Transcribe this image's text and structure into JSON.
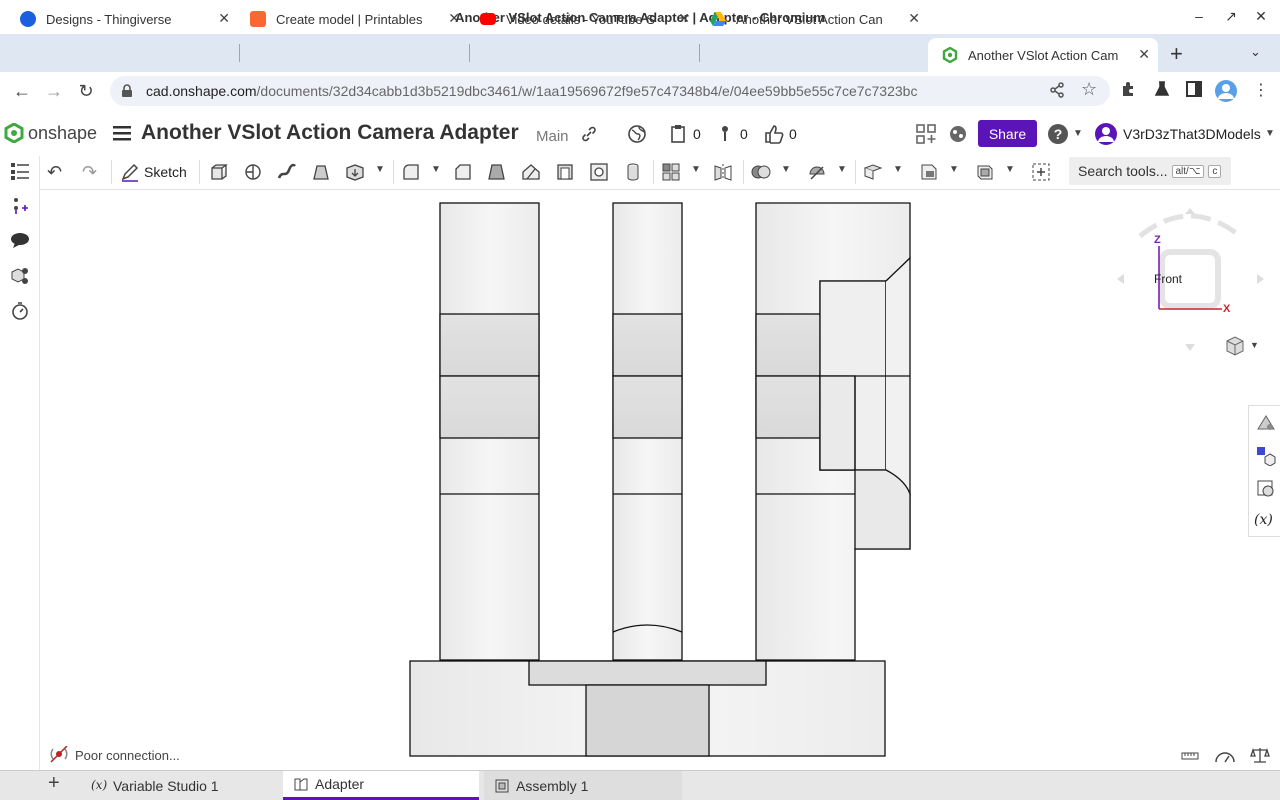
{
  "window": {
    "title": "Another VSlot Action Camera Adapter | Adapter - Chromium"
  },
  "browser_tabs": [
    {
      "label": "Designs - Thingiverse",
      "icon": "thingiverse-icon",
      "color": "#1b5fe0"
    },
    {
      "label": "Create model | Printables",
      "icon": "printables-icon",
      "color": "#fa6831"
    },
    {
      "label": "Video details - YouTube S",
      "icon": "youtube-icon",
      "color": "#ff0000"
    },
    {
      "label": "Another VSlot Action Can",
      "icon": "google-drive-icon",
      "color": "#1fa463"
    },
    {
      "label": "Another VSlot Action Cam",
      "icon": "onshape-icon",
      "color": "#3fa83f"
    }
  ],
  "address_bar": {
    "host": "cad.onshape.com",
    "path": "/documents/32d34cabb1d3b5219dbc3461/w/1aa19569672f9e57c47348b4/e/04ee59bb5e55c7ce7c7323bc"
  },
  "app": {
    "logo_text": "onshape",
    "document_title": "Another VSlot Action Camera Adapter",
    "branch": "Main",
    "version_count": "0",
    "notifications_count": "0",
    "likes_count": "0",
    "share_label": "Share",
    "user_name": "V3rD3zThat3DModels",
    "brand_color": "#5b14b8"
  },
  "toolbar": {
    "sketch_label": "Sketch",
    "search_placeholder": "Search tools...",
    "search_shortcut_1": "alt/⌥",
    "search_shortcut_2": "c"
  },
  "view_cube": {
    "face_label": "Front",
    "axis_z": "Z",
    "axis_x": "X"
  },
  "status": {
    "message": "Poor connection..."
  },
  "bottom_tabs": [
    {
      "label": "Variable Studio 1",
      "active": false
    },
    {
      "label": "Adapter",
      "active": true
    },
    {
      "label": "Assembly 1",
      "active": false
    }
  ]
}
